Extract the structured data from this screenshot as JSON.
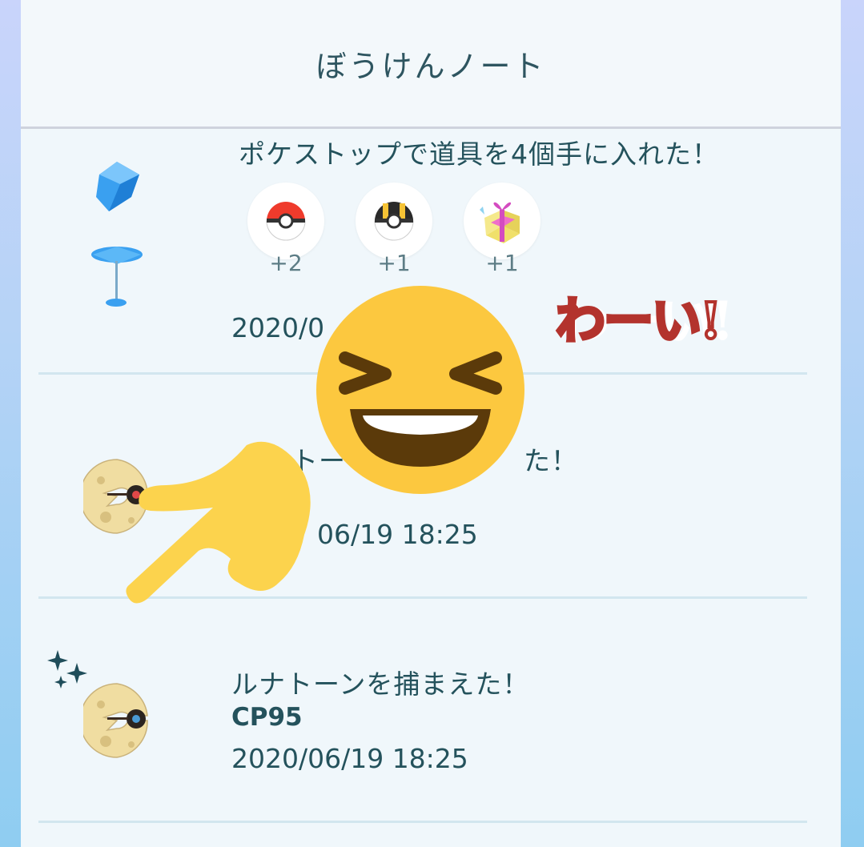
{
  "header": {
    "title": "ぼうけんノート"
  },
  "entries": [
    {
      "text": "ポケストップで道具を4個手に入れた！",
      "date": "2020/0",
      "items": [
        {
          "name": "poke-ball-icon",
          "count": "+2"
        },
        {
          "name": "ultra-ball-icon",
          "count": "+1"
        },
        {
          "name": "gift-icon",
          "count": "+1"
        }
      ]
    },
    {
      "text_a": "ト",
      "text_b": "ー",
      "text_c": "た！",
      "date": "06/19 18:25"
    },
    {
      "text": "ルナトーンを捕まえた！",
      "cp": "CP95",
      "date": "2020/06/19 18:25"
    }
  ],
  "overlay": {
    "sticker_text": "わーい!"
  },
  "colors": {
    "panel": "#f0f7fb",
    "text": "#24525c",
    "separator": "#d2e6ef",
    "emoji": "#fcc83f"
  }
}
